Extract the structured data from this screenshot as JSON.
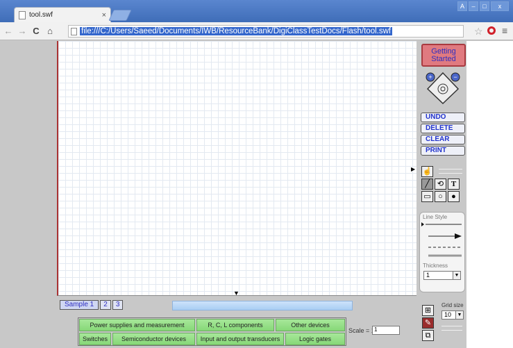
{
  "browser": {
    "tab_title": "tool.swf",
    "tab_close": "×",
    "url": "file:///C:/Users/Saeed/Documents/IWB/ResourceBank/DigiClassTestDocs/Flash/tool.swf",
    "win_buttons": [
      "A",
      "–",
      "□",
      "x"
    ]
  },
  "tool": {
    "getting_started": "Getting Started",
    "actions": [
      "UNDO",
      "DELETE",
      "CLEAR",
      "PRINT"
    ],
    "line_style_label": "Line Style",
    "thickness_label": "Thickness",
    "thickness_value": "1",
    "grid_size_label": "Grid size",
    "grid_size_value": "10",
    "text_tool": "T",
    "samples": [
      "Sample 1",
      "2",
      "3"
    ],
    "categories_row1": [
      "Power supplies and measurement",
      "R, C, L components",
      "Other devices"
    ],
    "categories_row2": [
      "Switches",
      "Semiconductor devices",
      "Input and output transducers",
      "Logic gates"
    ],
    "scale_label": "Scale = 1 :",
    "scale_value": "1"
  }
}
